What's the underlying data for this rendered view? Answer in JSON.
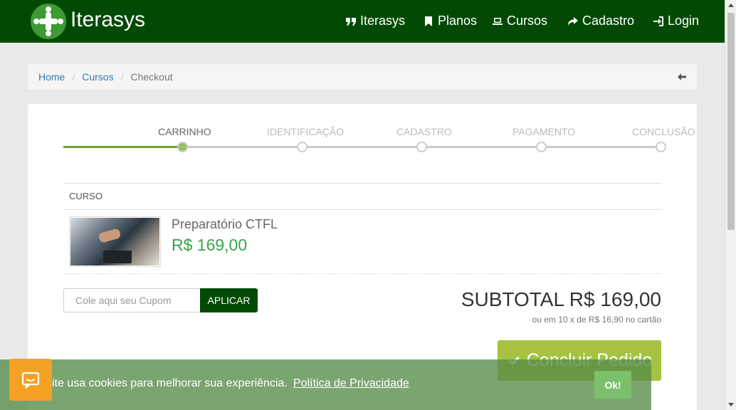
{
  "navbar": {
    "brand": "Iterasys",
    "items": [
      {
        "label": "Iterasys",
        "icon": "quote-icon"
      },
      {
        "label": "Planos",
        "icon": "bookmark-icon"
      },
      {
        "label": "Cursos",
        "icon": "laptop-icon"
      },
      {
        "label": "Cadastro",
        "icon": "share-icon"
      },
      {
        "label": "Login",
        "icon": "sign-in-icon"
      }
    ]
  },
  "breadcrumb": {
    "items": [
      "Home",
      "Cursos"
    ],
    "active": "Checkout"
  },
  "steps": {
    "labels": [
      "CARRINHO",
      "IDENTIFICAÇÃO",
      "CADASTRO",
      "PAGAMENTO",
      "CONCLUSÃO"
    ],
    "active_index": 0
  },
  "cart": {
    "column_header": "CURSO",
    "item": {
      "name": "Preparatório CTFL",
      "price": "R$ 169,00"
    }
  },
  "coupon": {
    "placeholder": "Cole aqui seu Cupom",
    "button": "APLICAR"
  },
  "summary": {
    "subtotal": "SUBTOTAL R$ 169,00",
    "installments": "ou em 10 x de R$ 16,90 no cartão",
    "finish_button": "Concluir Pedido"
  },
  "cookie": {
    "text": "ite usa cookies para melhorar sua experiência.",
    "link": "Política de Privacidade",
    "ok": "Ok!"
  },
  "colors": {
    "navbar": "#024a03",
    "accent_green": "#6ea22e",
    "price_green": "#3aa24a",
    "finish_button": "#a6c240",
    "cookie_icon": "#f4a124"
  }
}
